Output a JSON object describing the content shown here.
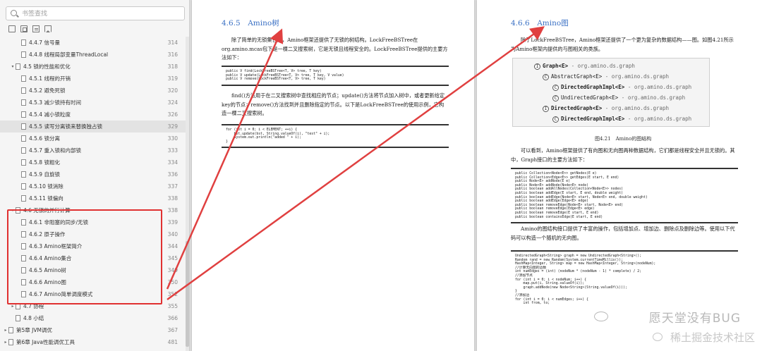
{
  "sidebar": {
    "search_placeholder": "书签查找",
    "toc": [
      {
        "label": "4.4.7 信号量",
        "page": "314",
        "level": 2
      },
      {
        "label": "4.4.8 线程局部变量ThreadLocal",
        "page": "316",
        "level": 2
      },
      {
        "label": "4.5 锁的性能和优化",
        "page": "318",
        "level": 1,
        "expanded": true
      },
      {
        "label": "4.5.1 线程的开销",
        "page": "319",
        "level": 2
      },
      {
        "label": "4.5.2 避免死锁",
        "page": "320",
        "level": 2
      },
      {
        "label": "4.5.3 减少锁持有时间",
        "page": "324",
        "level": 2
      },
      {
        "label": "4.5.4 减小锁粒度",
        "page": "326",
        "level": 2
      },
      {
        "label": "4.5.5 读写分离锁来替换独占锁",
        "page": "329",
        "level": 2,
        "selected": true
      },
      {
        "label": "4.5.6 锁分离",
        "page": "330",
        "level": 2
      },
      {
        "label": "4.5.7 重入锁和内部锁",
        "page": "333",
        "level": 2
      },
      {
        "label": "4.5.8 锁粗化",
        "page": "334",
        "level": 2
      },
      {
        "label": "4.5.9 自旋锁",
        "page": "336",
        "level": 2
      },
      {
        "label": "4.5.10 锁消除",
        "page": "337",
        "level": 2
      },
      {
        "label": "4.5.11 锁偏向",
        "page": "338",
        "level": 2
      },
      {
        "label": "4.6 无锁的并行计算",
        "page": "338",
        "level": 1,
        "expanded": true
      },
      {
        "label": "4.6.1 非阻塞的同步/无锁",
        "page": "339",
        "level": 2
      },
      {
        "label": "4.6.2 原子操作",
        "page": "340",
        "level": 2
      },
      {
        "label": "4.6.3 Amino框架简介",
        "page": "344",
        "level": 2
      },
      {
        "label": "4.6.4 Amino集合",
        "page": "345",
        "level": 2
      },
      {
        "label": "4.6.5 Amino树",
        "page": "349",
        "level": 2
      },
      {
        "label": "4.6.6 Amino图",
        "page": "350",
        "level": 2
      },
      {
        "label": "4.6.7 Amino简单调度模式",
        "page": "352",
        "level": 2
      },
      {
        "label": "4.7 协程",
        "page": "355",
        "level": 1,
        "expanded": false
      },
      {
        "label": "4.8 小结",
        "page": "366",
        "level": 1,
        "leaf": true
      },
      {
        "label": "第5章 JVM调优",
        "page": "367",
        "level": 0,
        "expanded": false
      },
      {
        "label": "第6章 Java性能调优工具",
        "page": "481",
        "level": 0,
        "expanded": false
      }
    ]
  },
  "left_page": {
    "section_title": "4.6.5　Amino树",
    "para1": "除了简单的无锁集合外，Amino框架还提供了无锁的树结构。LockFreeBSTree在org.amino.mcas包下是一棵二叉搜索树，它是无锁且线程安全的。LockFreeBSTree提供的主要方法如下：",
    "code1": "public V find(LockFreeBSTree<T, V> tree, T key)\npublic V update(LockFreeBSTree<T, V> tree, T key, V value)\npublic V remove(LockFreeBSTree<T, V> tree, T key)",
    "para2": "find()方法用于在二叉搜索树中查找相应的节点；update()方法将节点加入树中，或者更新给定key的节点；remove()方法找到并且删除指定的节点。以下是LockFreeBSTree的使用示例，它构造一棵二叉搜索树。",
    "code2": "for (int i = 0; i < ELEMENT; ++i) {\n    bst.update(bst, String.valueOf(i), \"test\" + i);\n    System.out.println(\"added \" + i);\n}"
  },
  "right_page": {
    "section_title": "4.6.6　Amino图",
    "para1": "除了LockFreeBSTree，Amino框架还提供了一个更为复杂的数据结构——图。如图4.21所示为Amino框架内提供的与图相关的类族。",
    "figure": {
      "nodes": [
        {
          "name": "Graph<E>",
          "pkg": " - org.amino.ds.graph",
          "bold": true
        },
        {
          "name": "AbstractGraph<E>",
          "pkg": " - org.amino.ds.graph",
          "bold": false
        },
        {
          "name": "DirectedGraphImpl<E>",
          "pkg": " - org.amino.ds.graph",
          "bold": true
        },
        {
          "name": "UndirectedGraph<E>",
          "pkg": " - org.amino.ds.graph",
          "bold": false
        },
        {
          "name": "DirectedGraph<E>",
          "pkg": " - org.amino.ds.graph",
          "bold": true
        },
        {
          "name": "DirectedGraphImpl<E>",
          "pkg": " - org.amino.ds.graph",
          "bold": true
        }
      ],
      "caption": "图4.21　Amino的图结构"
    },
    "para2": "可以看到，Amino框架提供了有向图和无向图两种数据结构，它们都是线程安全并且无锁的。其中，Graph接口的主要方法如下：",
    "code1": "public Collection<Node<E>> getNodes(E e)\npublic Collection<Edge<E>> getEdges(E start, E end)\npublic Node<E> addNode(E e)\npublic Node<E> addNode(Node<E> node)\npublic boolean addAllNodes(Collection<Node<E>> nodes)\npublic boolean addEdge(E start, E end, double weight)\npublic boolean addEdge(Node<E> start, Node<E> end, double weight)\npublic boolean addEdge(Edge<E> edge)\npublic boolean removeEdge(Node<E> start, Node<E> end)\npublic boolean removeEdge(Edge<E> edge)\npublic boolean removeEdge(E start, E end)\npublic boolean containsEdge(E start, E end)",
    "para3": "Amino的图结构接口提供了丰富的操作，包括增加点、增加边、删除点及删除边等。使用以下代码可以构造一个随机的无向图。",
    "code2": "UndirectedGraph<String> graph = new UndirectedGraph<String>();\nRandom rand = new Random(System.currentTimeMillis());\nHashMap<Integer, String> map = new HashMap<Integer, String>(nodeNum);\n//计算无向图的边数\nint numEdges = (int) (nodeNum * (nodeNum - 1) * complete) / 2;\n//添加节点\nfor (int i = 0; i < nodeNum; i++) {\n    map.put(i, String.valueOf(i));\n    graph.addNode(new Node<String>(String.valueOf(i)));\n}\n//添加边\nfor (int i = 0; i < numEdges; i++) {\n    int from, to;"
  },
  "watermark": {
    "text": "愿天堂没有BUG",
    "brand": "稀土掘金技术社区"
  },
  "colors": {
    "title_blue": "#3a70c4",
    "highlight_red": "#e03030",
    "arrow_red": "#e04040"
  }
}
